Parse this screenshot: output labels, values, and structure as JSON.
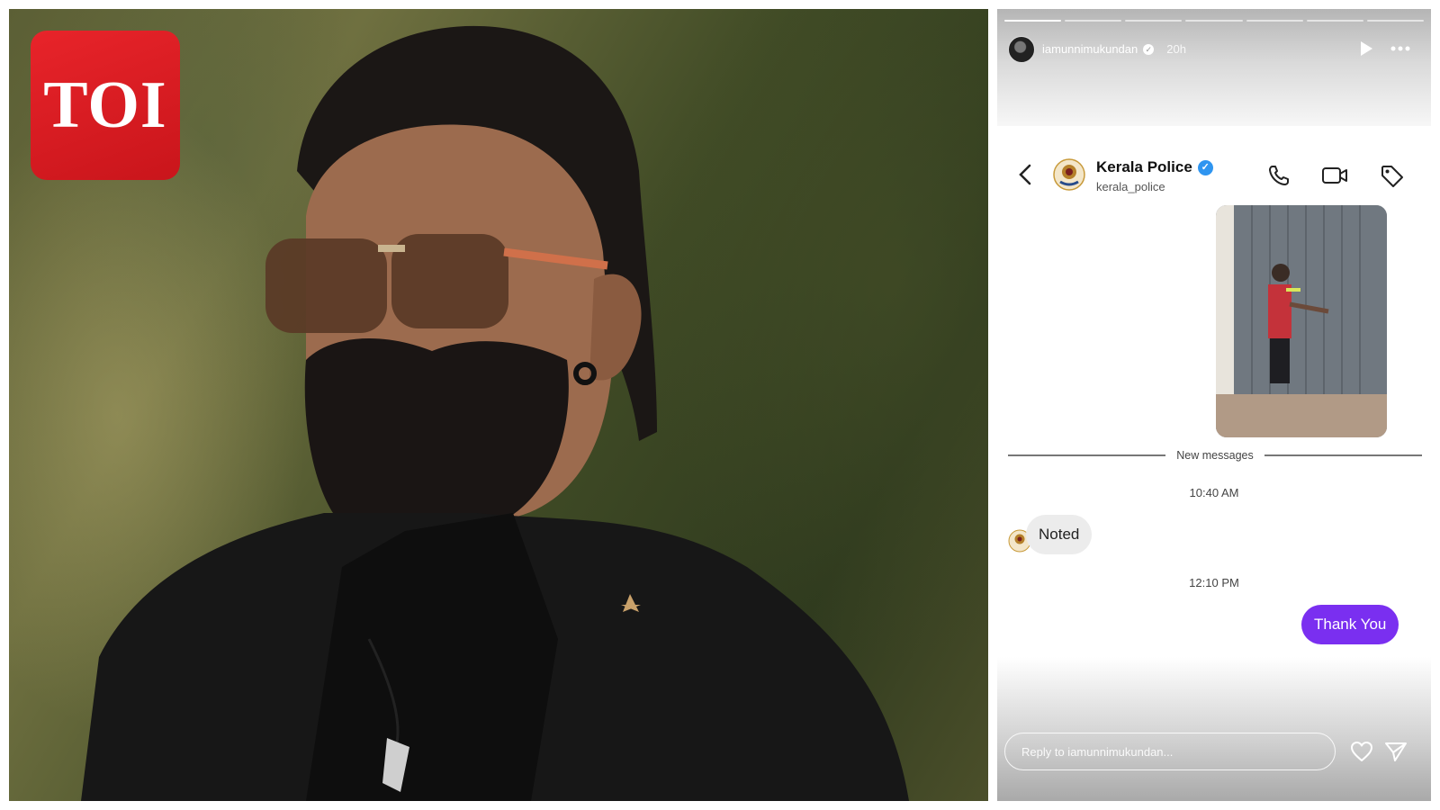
{
  "logo": {
    "text": "TOI",
    "color": "#d61a20"
  },
  "story": {
    "username": "iamunnimukundan",
    "time_ago": "20h",
    "progress_segments": 7,
    "progress_completed": 1,
    "icons": [
      "play-icon",
      "more-icon"
    ]
  },
  "dm": {
    "contact_name": "Kerala Police",
    "contact_handle": "kerala_police",
    "verified": true,
    "header_icons": [
      "back-icon",
      "call-icon",
      "video-icon",
      "tag-icon"
    ],
    "new_messages_label": "New messages",
    "messages": [
      {
        "time": "10:40 AM",
        "direction": "incoming",
        "text": "Noted"
      },
      {
        "time": "12:10 PM",
        "direction": "outgoing",
        "text": "Thank You"
      }
    ],
    "outgoing_color": "#7a2ff0",
    "reply_placeholder": "Reply to iamunnimukundan..."
  }
}
